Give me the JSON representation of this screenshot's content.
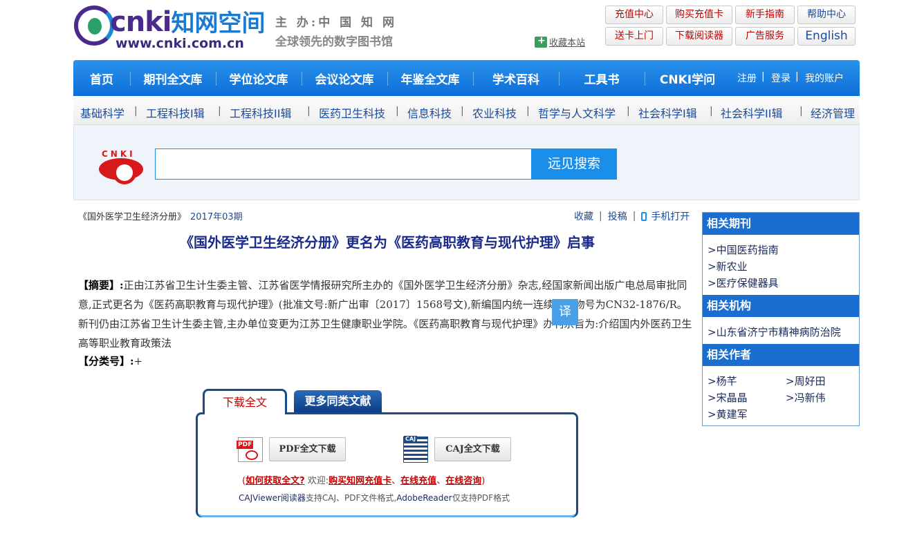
{
  "header": {
    "logo_brand": "cnki",
    "logo_brand_cn": "知网空间",
    "logo_url": "www.cnki.com.cn",
    "sponsor": "主 办:中 国 知 网",
    "slogan": "全球领先的数字图书馆",
    "favorite": "收藏本站",
    "buttons": [
      {
        "label": "充值中心"
      },
      {
        "label": "购买充值卡"
      },
      {
        "label": "新手指南"
      },
      {
        "label": "帮助中心"
      },
      {
        "label": "送卡上门"
      },
      {
        "label": "下载阅读器"
      },
      {
        "label": "广告服务"
      },
      {
        "label": "English"
      }
    ]
  },
  "nav": {
    "items": [
      {
        "label": "首页"
      },
      {
        "label": "期刊全文库"
      },
      {
        "label": "学位论文库"
      },
      {
        "label": "会议论文库"
      },
      {
        "label": "年鉴全文库"
      },
      {
        "label": "学术百科"
      },
      {
        "label": "工具书"
      },
      {
        "label": "CNKI学问"
      }
    ],
    "account": [
      "注册",
      "登录",
      "我的账户"
    ]
  },
  "subnav": {
    "items": [
      "基础科学",
      "工程科技I辑",
      "工程科技II辑",
      "医药卫生科技",
      "信息科技",
      "农业科技",
      "哲学与人文科学",
      "社会科学I辑",
      "社会科学II辑",
      "经济管理"
    ]
  },
  "search": {
    "logo_text": "CNKI",
    "input_value": "",
    "button": "远见搜索"
  },
  "article": {
    "journal": "《国外医学卫生经济分册》",
    "issue": "2017年03期",
    "actions": [
      "收藏",
      "投稿",
      "手机打开"
    ],
    "title": "《国外医学卫生经济分册》更名为《医药高职教育与现代护理》启事",
    "abstract_label": "【摘要】:",
    "abstract_text": "正由江苏省卫生计生委主管、江苏省医学情报研究所主办的《国外医学卫生经济分册》杂志,经国家新闻出版广电总局审批同意,正式更名为《医药高职教育与现代护理》(批准文号:新广出审〔2017〕1568号文),新编国内统一连续出版物号为CN32-1876/R。新刊仍由江苏省卫生计生委主管,主办单位变更为江苏卫生健康职业学院。《医药高职教育与现代护理》办刊宗旨为:介绍国内外医药卫生高等职业教育政策法",
    "class_label": "【分类号】:",
    "class_value": "+",
    "translate": "译"
  },
  "download": {
    "tab_active": "下载全文",
    "tab_more": "更多同类文献",
    "pdf_button": "PDF全文下载",
    "caj_button": "CAJ全文下载",
    "paren_open": "(",
    "howto": "如何获取全文?",
    "welcome": " 欢迎:",
    "buy_card": "购买知网充值卡",
    "sep1": "、",
    "online_recharge": "在线充值",
    "sep2": "、",
    "online_consult": "在线咨询",
    "paren_close": ")",
    "viewer_caj": "CAJViewer阅读器",
    "viewer_mid": "支持CAJ、PDF文件格式,",
    "viewer_adobe": "AdobeReader",
    "viewer_end": "仅支持PDF格式"
  },
  "sidebar": {
    "journals_title": "相关期刊",
    "journals": [
      ">中国医药指南",
      ">新农业",
      ">医疗保健器具"
    ],
    "orgs_title": "相关机构",
    "orgs": [
      ">山东省济宁市精神病防治院"
    ],
    "authors_title": "相关作者",
    "authors": [
      ">杨芊",
      ">周好田",
      ">宋晶晶",
      ">冯新伟",
      ">黄建军"
    ]
  },
  "colors": {
    "nav_blue": "#1a7ee0",
    "title_blue": "#1a2a8a",
    "accent_red": "#c40000",
    "sidebar_header": "#1a6ed0"
  }
}
